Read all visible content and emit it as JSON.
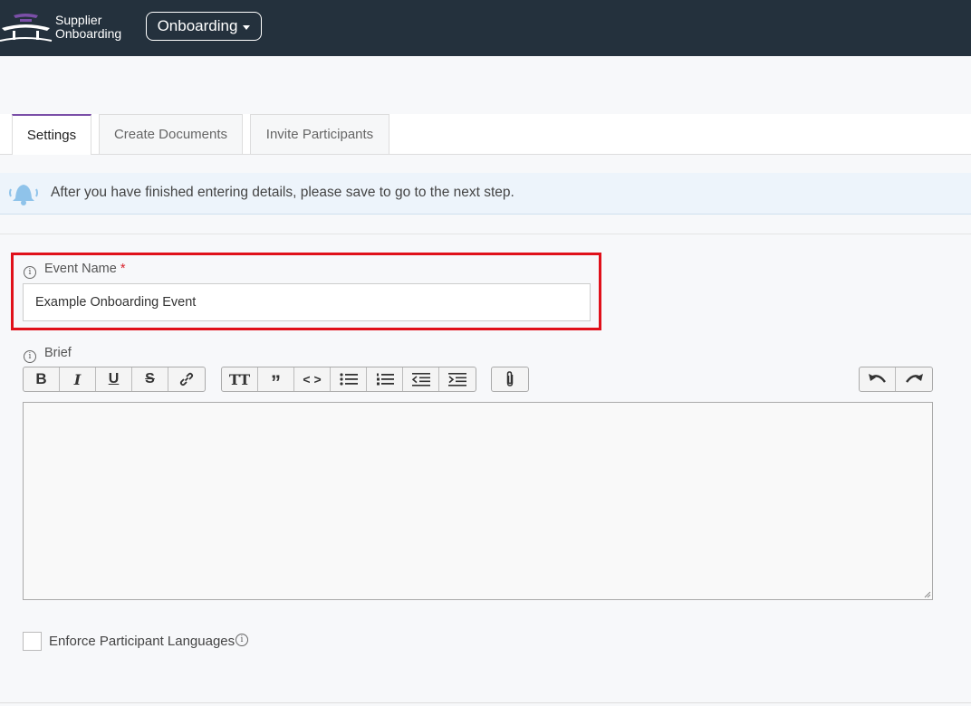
{
  "header": {
    "brand_line1": "Supplier",
    "brand_line2": "Onboarding",
    "module_label": "Onboarding",
    "background_color": "#24313d",
    "logo_color": "#7b4fa8"
  },
  "tabs": [
    {
      "label": "Settings",
      "active": true
    },
    {
      "label": "Create Documents",
      "active": false
    },
    {
      "label": "Invite Participants",
      "active": false
    }
  ],
  "notice": {
    "icon": "bell-icon",
    "text": "After you have finished entering details, please save to go to the next step."
  },
  "form": {
    "event_name": {
      "label": "Event Name",
      "required_mark": "*",
      "value": "Example Onboarding Event",
      "highlight_color": "#e0101a"
    },
    "brief": {
      "label": "Brief",
      "value": ""
    },
    "enforce_languages": {
      "label": "Enforce Participant Languages",
      "checked": false
    }
  },
  "toolbar": {
    "format_group": [
      "bold-icon",
      "italic-icon",
      "underline-icon",
      "strikethrough-icon",
      "link-icon"
    ],
    "block_group": [
      "heading-icon",
      "quote-icon",
      "code-icon",
      "bullet-list-icon",
      "numbered-list-icon",
      "outdent-icon",
      "indent-icon"
    ],
    "attach_group": [
      "attachment-icon"
    ],
    "history_group": [
      "undo-icon",
      "redo-icon"
    ]
  }
}
